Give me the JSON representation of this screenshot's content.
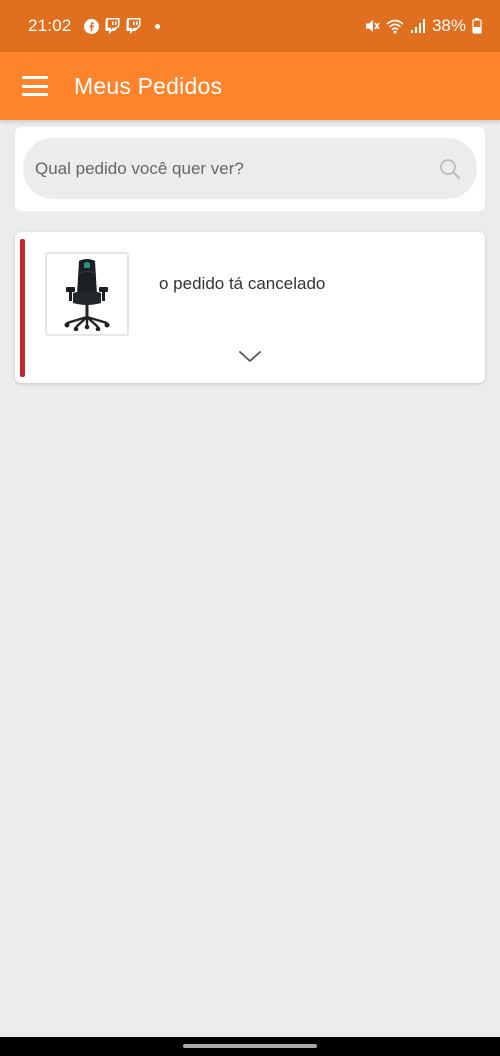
{
  "status_bar": {
    "time": "21:02",
    "battery": "38%",
    "notification_icons": [
      "facebook-icon",
      "twitch-icon",
      "twitch-icon"
    ],
    "system_icons": [
      "mute-icon",
      "wifi-icon",
      "signal-icon",
      "battery-icon"
    ]
  },
  "app_bar": {
    "title": "Meus Pedidos",
    "background": "#fd842a"
  },
  "search": {
    "placeholder": "Qual pedido você quer ver?"
  },
  "orders": [
    {
      "status_text": "o pedido tá cancelado",
      "status_color": "#c8242c",
      "thumbnail": "gaming-chair-icon"
    }
  ]
}
